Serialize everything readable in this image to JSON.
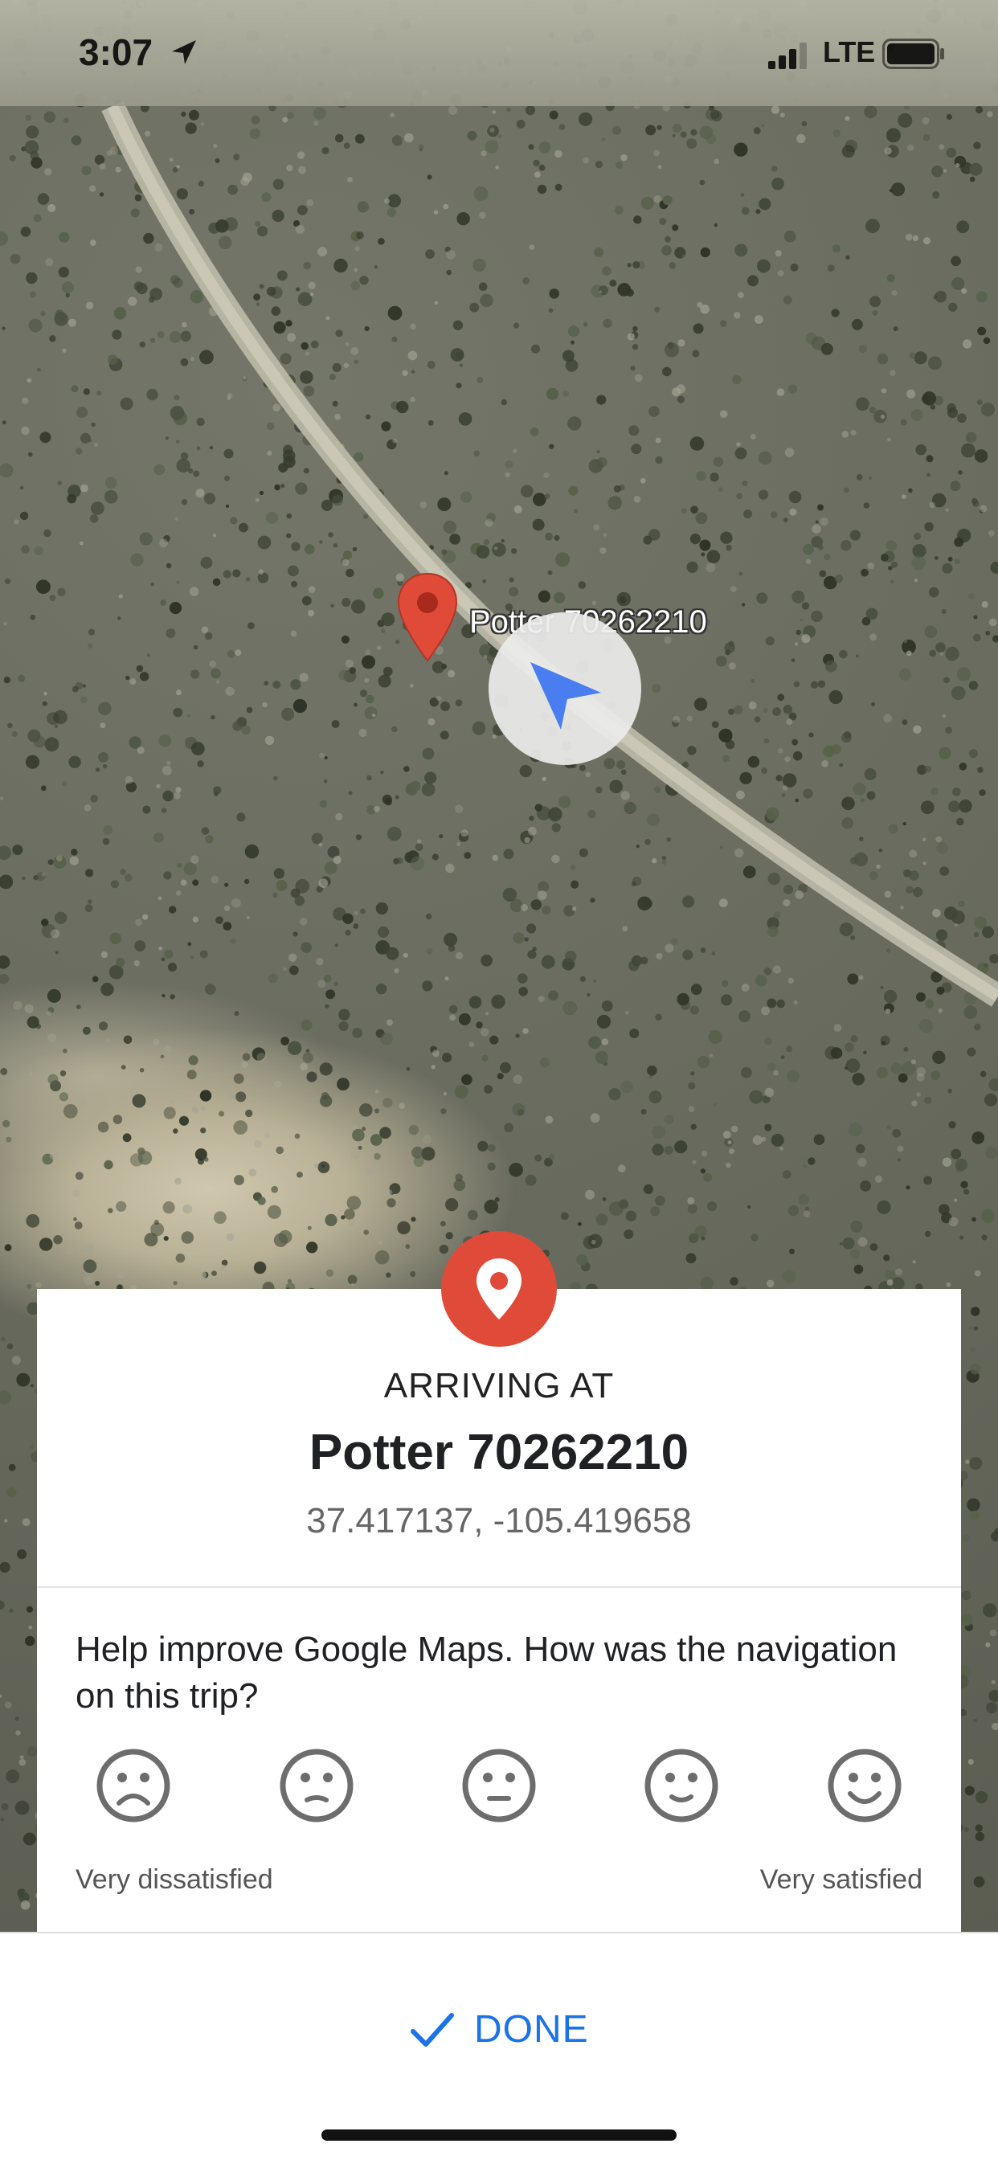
{
  "status_bar": {
    "time": "3:07",
    "network": "LTE",
    "icons": [
      "location-arrow-icon",
      "signal-icon",
      "battery-icon"
    ]
  },
  "map": {
    "pin_label": "Potter 70262210",
    "pin_color": "#e04b39",
    "puck_color": "#4285f4",
    "view": "satellite"
  },
  "arrival": {
    "arriving_label": "ARRIVING AT",
    "destination_name": "Potter 70262210",
    "coordinates": "37.417137, -105.419658",
    "badge_icon": "map-pin-icon"
  },
  "feedback": {
    "question": "Help improve Google Maps. How was the navigation on this trip?",
    "scale_min_label": "Very dissatisfied",
    "scale_max_label": "Very satisfied",
    "options": [
      {
        "icon": "very-dissatisfied-face-icon"
      },
      {
        "icon": "dissatisfied-face-icon"
      },
      {
        "icon": "neutral-face-icon"
      },
      {
        "icon": "satisfied-face-icon"
      },
      {
        "icon": "very-satisfied-face-icon"
      }
    ]
  },
  "bottom_bar": {
    "done_label": "DONE",
    "accent_color": "#1a73e8"
  }
}
